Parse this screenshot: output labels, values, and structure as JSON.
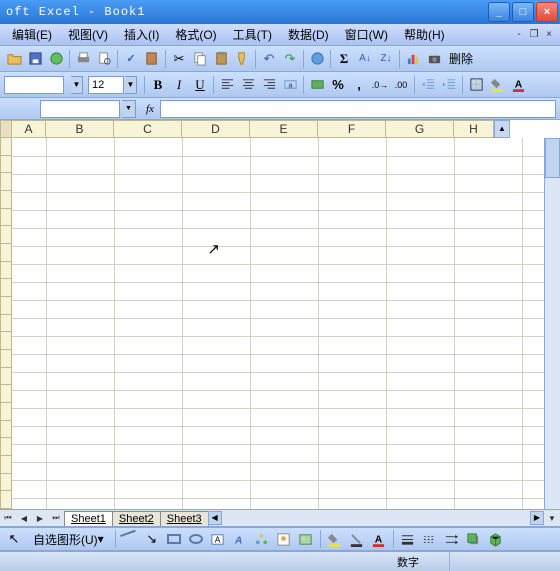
{
  "title": "oft Excel - Book1",
  "menu": {
    "edit": "编辑(E)",
    "view": "视图(V)",
    "insert": "插入(I)",
    "format": "格式(O)",
    "tools": "工具(T)",
    "data": "数据(D)",
    "window": "窗口(W)",
    "help": "帮助(H)"
  },
  "toolbar": {
    "delete_label": "删除"
  },
  "format": {
    "font_size": "12"
  },
  "columns": [
    "A",
    "B",
    "C",
    "D",
    "E",
    "F",
    "G",
    "H"
  ],
  "sheets": [
    "Sheet1",
    "Sheet2",
    "Sheet3"
  ],
  "drawing": {
    "autoshapes": "自选图形(U)"
  },
  "status": {
    "numlock": "数字"
  },
  "chart_data": null
}
